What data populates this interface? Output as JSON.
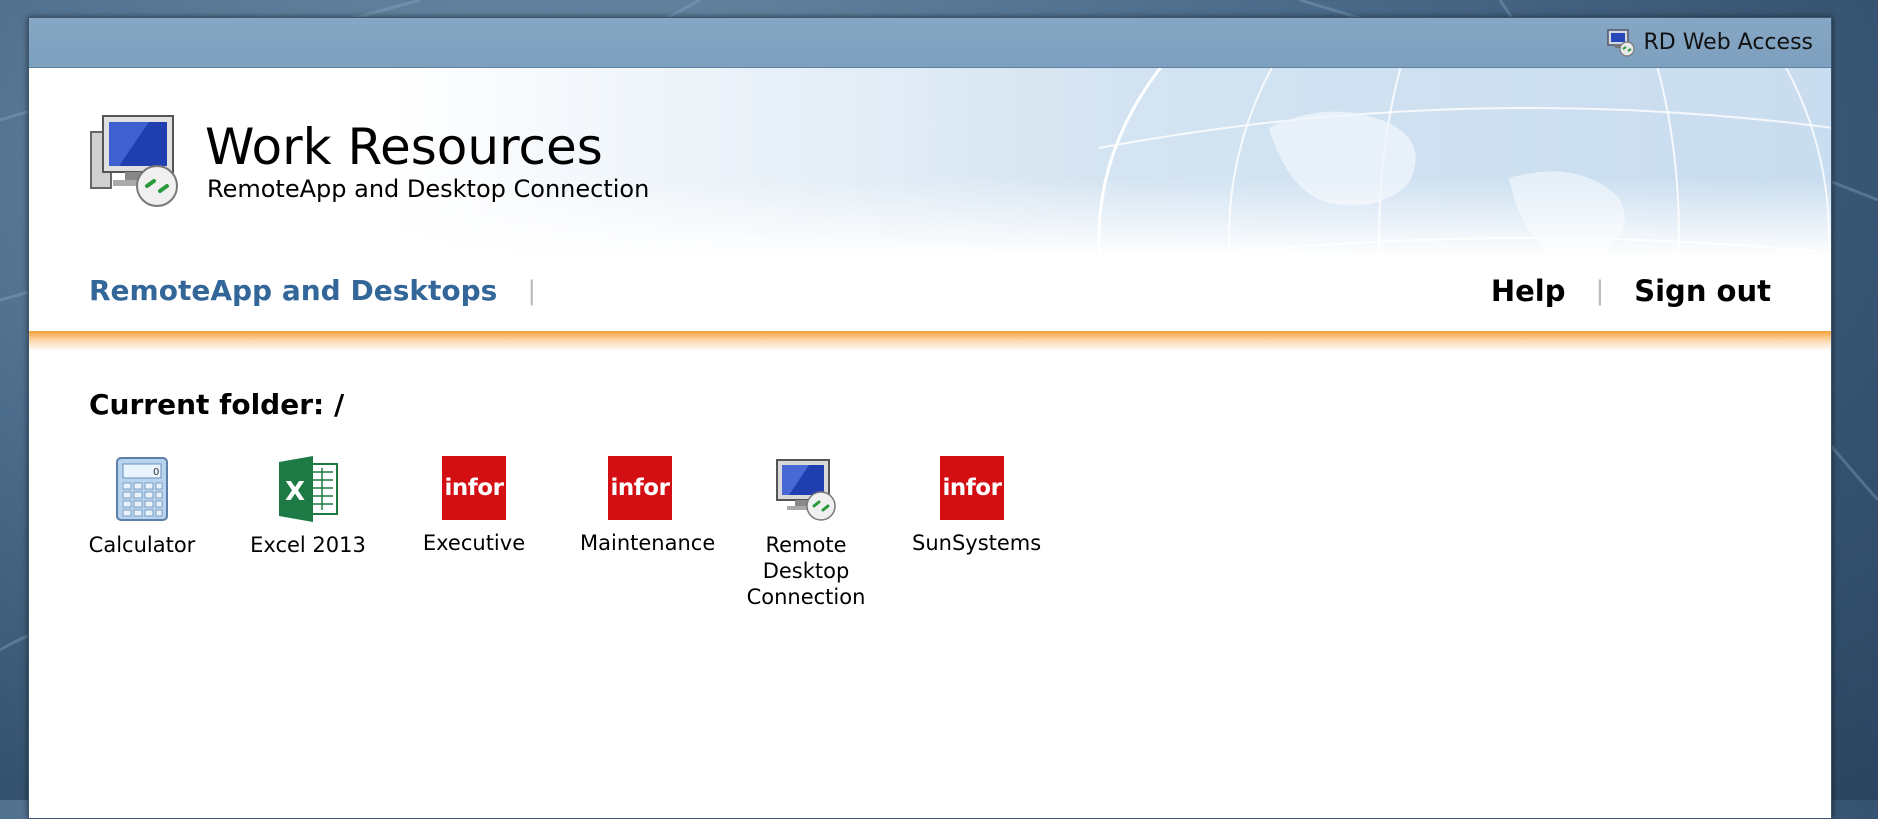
{
  "header": {
    "product_label": "RD Web Access",
    "title": "Work Resources",
    "subtitle": "RemoteApp and Desktop Connection"
  },
  "nav": {
    "current_section": "RemoteApp and Desktops",
    "help": "Help",
    "sign_out": "Sign out"
  },
  "folder": {
    "current_folder_label": "Current folder: /"
  },
  "apps": [
    {
      "label": "Calculator",
      "icon": "calculator-icon"
    },
    {
      "label": "Excel 2013",
      "icon": "excel-icon"
    },
    {
      "label": "Executive",
      "icon": "infor-icon",
      "icon_text": "infor"
    },
    {
      "label": "Maintenance",
      "icon": "infor-icon",
      "icon_text": "infor"
    },
    {
      "label": "Remote Desktop Connection",
      "icon": "remote-desktop-icon"
    },
    {
      "label": "SunSystems",
      "icon": "infor-icon",
      "icon_text": "infor"
    }
  ],
  "colors": {
    "accent_orange": "#f5a13c",
    "nav_blue": "#336699",
    "infor_red": "#d40f14",
    "topbar": "#7da0bf"
  }
}
